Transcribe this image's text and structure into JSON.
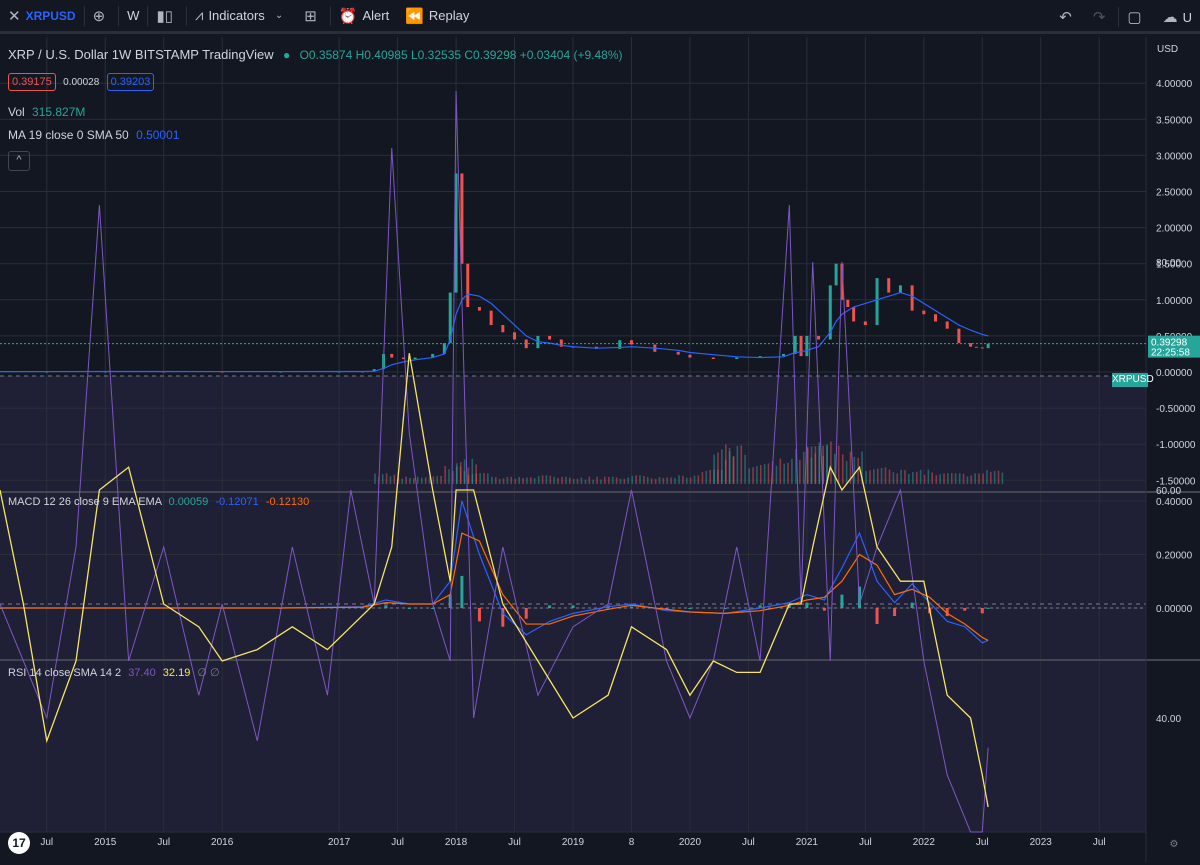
{
  "toolbar": {
    "close_icon": "x-icon",
    "symbol": "XRPUSD",
    "add_icon": "plus-circle-icon",
    "interval": "W",
    "chart_type_icon": "candles-icon",
    "indicators_label": "Indicators",
    "templates_icon": "grid-icon",
    "alert_label": "Alert",
    "replay_label": "Replay",
    "undo_icon": "undo-icon",
    "redo_icon": "redo-icon",
    "right_label": "U"
  },
  "legend": {
    "title": "XRP / U.S. Dollar  1W  BITSTAMP  TradingView",
    "ohlc": "O0.35874 H0.40985 L0.32535 C0.39298 +0.03404 (+9.48%)",
    "bid": "0.39175",
    "spread": "0.00028",
    "ask": "0.39203",
    "vol_label": "Vol",
    "vol_value": "315.827M",
    "ma_label": "MA 19 close 0 SMA 50",
    "ma_value": "0.50001",
    "macd_label": "MACD 12 26 close 9 EMA EMA",
    "macd_hist": "0.00059",
    "macd_line": "-0.12071",
    "macd_signal": "-0.12130",
    "rsi_label": "RSI 14 close SMA 14 2",
    "rsi_value": "37.40",
    "rsi_ma": "32.19",
    "rsi_extra": "∅ ∅"
  },
  "price_label": {
    "symbol": "XRPUSD",
    "price": "0.39298",
    "countdown": "22:25:58"
  },
  "logo": "17",
  "colors": {
    "up": "#26a69a",
    "down": "#ef5350",
    "ma": "#2962ff",
    "macd": "#2962ff",
    "signal": "#ff6d00",
    "rsi": "#7e57c2",
    "rsi_ma": "#f7e463"
  },
  "chart_data": {
    "type": "line",
    "price_axis": {
      "currency": "USD",
      "ticks": [
        "4.00000",
        "3.50000",
        "3.00000",
        "2.50000",
        "2.00000",
        "1.50000",
        "1.00000",
        "0.50000",
        "0.00000",
        "-0.50000",
        "-1.00000",
        "-1.50000"
      ],
      "tick_values": [
        4.0,
        3.5,
        3.0,
        2.5,
        2.0,
        1.5,
        1.0,
        0.5,
        0.0,
        -0.5,
        -1.0,
        -1.5
      ]
    },
    "macd_axis": {
      "ticks": [
        "0.40000",
        "0.20000",
        "0.00000"
      ],
      "tick_values": [
        0.4,
        0.2,
        0.0
      ]
    },
    "rsi_axis": {
      "ticks": [
        "80.00",
        "60.00",
        "40.00"
      ],
      "tick_values": [
        80,
        60,
        40
      ],
      "bands": [
        70,
        50,
        30
      ]
    },
    "x_axis": {
      "ticks": [
        "Jul",
        "2015",
        "Jul",
        "2016",
        "2017",
        "Jul",
        "2018",
        "Jul",
        "2019",
        "8",
        "2020",
        "Jul",
        "2021",
        "Jul",
        "2022",
        "Jul",
        "2023",
        "Jul"
      ],
      "tick_values": [
        2014.5,
        2015.0,
        2015.5,
        2016.0,
        2017.0,
        2017.5,
        2018.0,
        2018.5,
        2019.0,
        2019.5,
        2020.0,
        2020.5,
        2021.0,
        2021.5,
        2022.0,
        2022.5,
        2023.0,
        2023.5
      ],
      "range": [
        2014.1,
        2023.9
      ]
    },
    "price": {
      "x": [
        2014.1,
        2014.5,
        2015.0,
        2015.5,
        2016.0,
        2016.5,
        2017.0,
        2017.2,
        2017.3,
        2017.38,
        2017.45,
        2017.55,
        2017.65,
        2017.8,
        2017.9,
        2017.95,
        2018.0,
        2018.05,
        2018.1,
        2018.2,
        2018.3,
        2018.4,
        2018.5,
        2018.6,
        2018.7,
        2018.8,
        2018.9,
        2019.0,
        2019.2,
        2019.4,
        2019.5,
        2019.7,
        2019.9,
        2020.0,
        2020.2,
        2020.4,
        2020.6,
        2020.8,
        2020.9,
        2020.95,
        2021.0,
        2021.1,
        2021.2,
        2021.25,
        2021.3,
        2021.35,
        2021.4,
        2021.5,
        2021.6,
        2021.7,
        2021.8,
        2021.9,
        2022.0,
        2022.1,
        2022.2,
        2022.3,
        2022.4,
        2022.45,
        2022.5,
        2022.55
      ],
      "close": [
        0.005,
        0.007,
        0.008,
        0.007,
        0.006,
        0.006,
        0.007,
        0.008,
        0.04,
        0.25,
        0.2,
        0.18,
        0.2,
        0.25,
        0.4,
        1.1,
        2.75,
        1.5,
        0.9,
        0.85,
        0.65,
        0.55,
        0.45,
        0.33,
        0.5,
        0.45,
        0.35,
        0.35,
        0.32,
        0.44,
        0.38,
        0.28,
        0.24,
        0.2,
        0.18,
        0.2,
        0.22,
        0.25,
        0.5,
        0.22,
        0.5,
        0.45,
        1.2,
        1.5,
        1.0,
        0.9,
        0.7,
        0.65,
        1.3,
        1.1,
        1.2,
        0.85,
        0.8,
        0.7,
        0.6,
        0.4,
        0.35,
        0.34,
        0.33,
        0.39298
      ],
      "ma50": [
        0.005,
        0.006,
        0.007,
        0.007,
        0.006,
        0.006,
        0.007,
        0.007,
        0.01,
        0.05,
        0.1,
        0.14,
        0.17,
        0.2,
        0.25,
        0.45,
        0.8,
        1.0,
        1.08,
        1.05,
        0.95,
        0.8,
        0.65,
        0.5,
        0.42,
        0.4,
        0.37,
        0.35,
        0.33,
        0.34,
        0.35,
        0.33,
        0.3,
        0.27,
        0.24,
        0.21,
        0.2,
        0.21,
        0.27,
        0.28,
        0.3,
        0.35,
        0.55,
        0.7,
        0.8,
        0.85,
        0.9,
        0.95,
        1.0,
        1.05,
        1.1,
        1.05,
        0.95,
        0.85,
        0.75,
        0.65,
        0.58,
        0.55,
        0.52,
        0.50001
      ]
    },
    "volume": {
      "x": [
        2017.3,
        2017.5,
        2017.7,
        2017.9,
        2018.0,
        2018.1,
        2018.3,
        2018.5,
        2018.7,
        2018.9,
        2019.1,
        2019.3,
        2019.5,
        2019.7,
        2019.9,
        2020.1,
        2020.2,
        2020.3,
        2020.5,
        2020.7,
        2020.9,
        2021.0,
        2021.1,
        2021.3,
        2021.5,
        2021.7,
        2021.9,
        2022.1,
        2022.3,
        2022.5
      ],
      "values": [
        0.15,
        0.1,
        0.12,
        0.25,
        0.35,
        0.15,
        0.1,
        0.1,
        0.12,
        0.1,
        0.1,
        0.1,
        0.12,
        0.1,
        0.12,
        0.2,
        0.5,
        0.55,
        0.3,
        0.35,
        0.5,
        0.85,
        0.6,
        0.45,
        0.25,
        0.2,
        0.2,
        0.15,
        0.15,
        0.2
      ]
    },
    "macd": {
      "x": [
        2014.1,
        2016.5,
        2017.2,
        2017.4,
        2017.6,
        2017.8,
        2017.95,
        2018.05,
        2018.2,
        2018.4,
        2018.6,
        2018.8,
        2019.0,
        2019.3,
        2019.5,
        2019.8,
        2020.0,
        2020.3,
        2020.6,
        2020.85,
        2021.0,
        2021.15,
        2021.3,
        2021.45,
        2021.6,
        2021.75,
        2021.9,
        2022.05,
        2022.2,
        2022.35,
        2022.5,
        2022.55
      ],
      "macd": [
        0.0,
        0.0,
        0.005,
        0.03,
        0.015,
        0.015,
        0.1,
        0.4,
        0.2,
        -0.02,
        -0.1,
        -0.05,
        -0.02,
        0.005,
        0.015,
        -0.01,
        -0.015,
        -0.02,
        0.0,
        0.02,
        0.05,
        0.03,
        0.15,
        0.28,
        0.1,
        0.02,
        0.09,
        0.02,
        -0.05,
        -0.07,
        -0.13,
        -0.12071
      ],
      "signal": [
        0.0,
        0.0,
        0.003,
        0.02,
        0.015,
        0.015,
        0.05,
        0.28,
        0.25,
        0.05,
        -0.06,
        -0.06,
        -0.03,
        -0.005,
        0.01,
        -0.005,
        -0.015,
        -0.02,
        -0.01,
        0.01,
        0.03,
        0.04,
        0.1,
        0.2,
        0.16,
        0.05,
        0.07,
        0.04,
        -0.02,
        -0.06,
        -0.11,
        -0.1213
      ],
      "hist": [
        0.0,
        0.0,
        0.002,
        0.01,
        0.0,
        0.0,
        0.05,
        0.12,
        -0.05,
        -0.07,
        -0.04,
        0.01,
        0.01,
        0.01,
        0.005,
        -0.005,
        0.0,
        0.0,
        0.01,
        0.01,
        0.02,
        -0.01,
        0.05,
        0.08,
        -0.06,
        -0.03,
        0.02,
        -0.02,
        -0.03,
        -0.01,
        -0.02,
        0.00059
      ]
    },
    "rsi": {
      "x": [
        2014.1,
        2014.3,
        2014.5,
        2014.75,
        2014.95,
        2015.2,
        2015.5,
        2015.8,
        2016.0,
        2016.3,
        2016.6,
        2016.9,
        2017.1,
        2017.3,
        2017.45,
        2017.6,
        2017.8,
        2017.95,
        2018.0,
        2018.15,
        2018.4,
        2018.7,
        2019.0,
        2019.3,
        2019.5,
        2019.8,
        2020.0,
        2020.2,
        2020.4,
        2020.6,
        2020.85,
        2020.95,
        2021.05,
        2021.2,
        2021.3,
        2021.45,
        2021.6,
        2021.8,
        2022.0,
        2022.2,
        2022.4,
        2022.5,
        2022.55
      ],
      "rsi": [
        50,
        45,
        40,
        55,
        85,
        45,
        55,
        42,
        50,
        38,
        55,
        42,
        60,
        50,
        90,
        65,
        50,
        45,
        95,
        40,
        55,
        42,
        48,
        50,
        60,
        45,
        40,
        45,
        55,
        45,
        85,
        50,
        80,
        45,
        80,
        50,
        55,
        60,
        45,
        35,
        30,
        30,
        37.4
      ],
      "rsi_ma": [
        60,
        50,
        38,
        45,
        60,
        62,
        50,
        48,
        45,
        46,
        48,
        46,
        48,
        50,
        55,
        72,
        60,
        52,
        60,
        60,
        50,
        45,
        40,
        42,
        48,
        46,
        42,
        45,
        44,
        44,
        50,
        50,
        55,
        62,
        60,
        62,
        55,
        52,
        52,
        42,
        40,
        35,
        32.19
      ]
    }
  }
}
